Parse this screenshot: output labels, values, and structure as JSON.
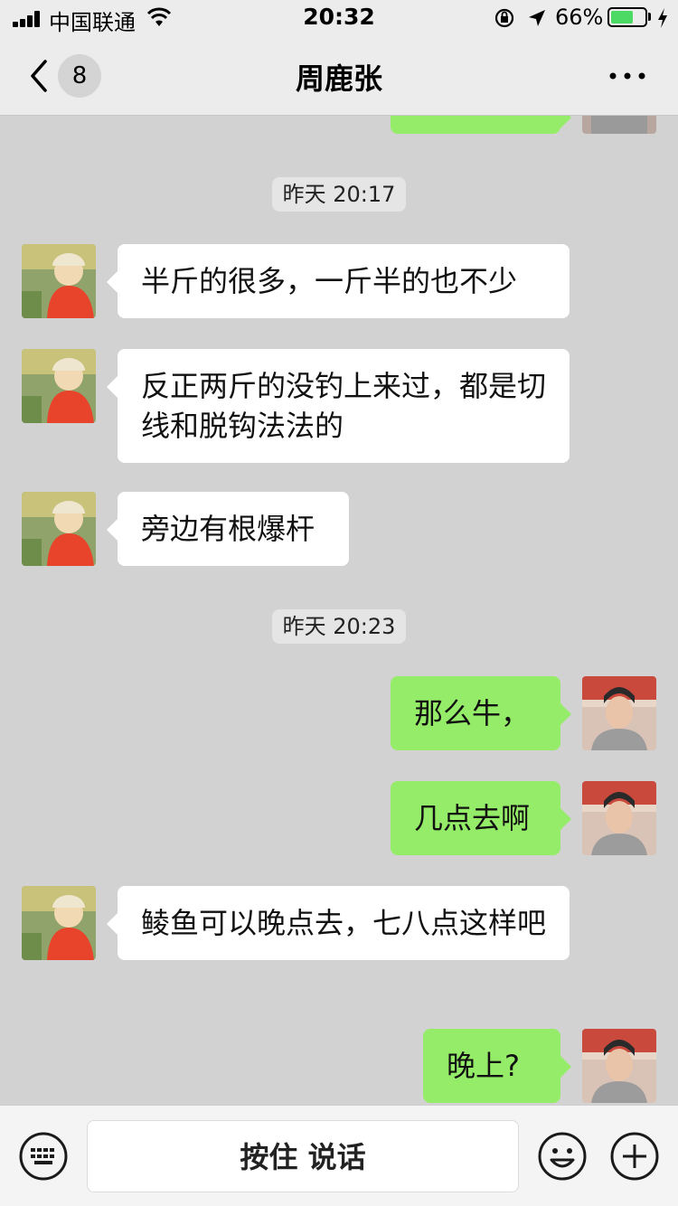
{
  "status_bar": {
    "carrier": "中国联通",
    "time": "20:32",
    "battery_percent_label": "66%",
    "battery_level": 0.66
  },
  "header": {
    "unread_count": "8",
    "title": "周鹿张"
  },
  "messages": [
    {
      "type": "timestamp",
      "text": "昨天 20:17"
    },
    {
      "type": "message",
      "side": "left",
      "text": "半斤的很多，一斤半的也不少"
    },
    {
      "type": "message",
      "side": "left",
      "text": "反正两斤的没钓上来过，都是切线和脱钩法法的"
    },
    {
      "type": "message",
      "side": "left",
      "text": "旁边有根爆杆"
    },
    {
      "type": "timestamp",
      "text": "昨天 20:23"
    },
    {
      "type": "message",
      "side": "right",
      "text": "那么牛，"
    },
    {
      "type": "message",
      "side": "right",
      "text": "几点去啊"
    },
    {
      "type": "message",
      "side": "left",
      "text": "鲮鱼可以晚点去，七八点这样吧"
    },
    {
      "type": "message",
      "side": "right",
      "text": "晚上?"
    }
  ],
  "input_bar": {
    "hold_to_talk_label": "按住 说话"
  },
  "colors": {
    "sent_bubble": "#95ec69",
    "received_bubble": "#ffffff",
    "chat_background": "#d2d2d2",
    "battery_green": "#4cd964"
  }
}
